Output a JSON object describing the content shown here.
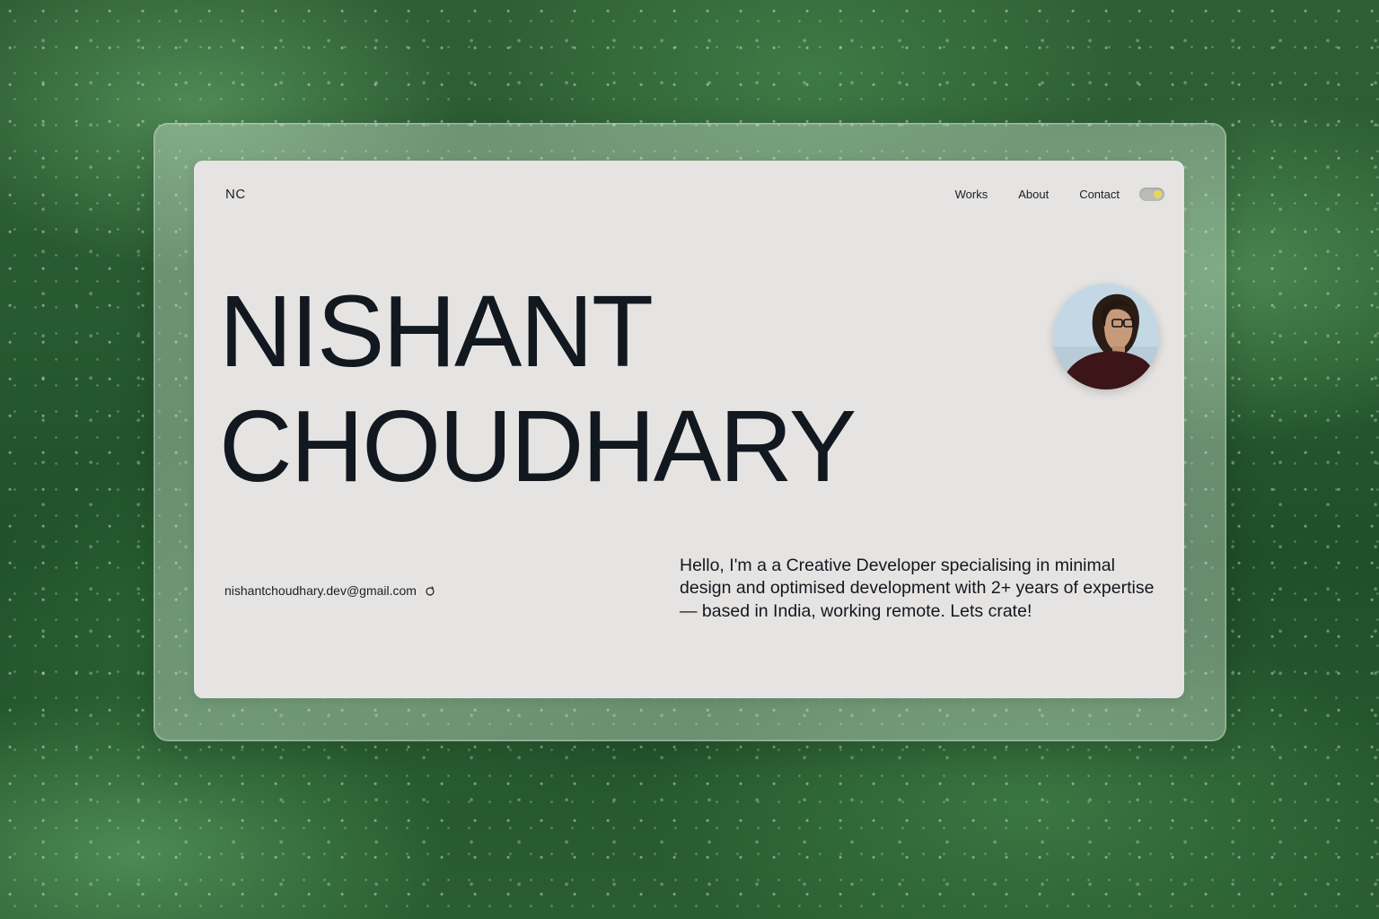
{
  "header": {
    "logo": "NC",
    "nav": [
      {
        "label": "Works"
      },
      {
        "label": "About"
      },
      {
        "label": "Contact"
      }
    ],
    "theme_toggle": {
      "state": "on",
      "knob_color": "#e8d65a"
    }
  },
  "hero": {
    "name_line1": "NISHANT",
    "name_line2": "CHOUDHARY"
  },
  "contact": {
    "email": "nishantchoudhary.dev@gmail.com",
    "copy_icon": "copy-icon"
  },
  "bio": {
    "text": "Hello, I'm a a Creative Developer specialising in minimal design and optimised development with 2+ years of expertise — based in India, working remote. Lets crate!"
  },
  "colors": {
    "card_bg": "#e6e4e2",
    "text": "#121820",
    "background_green": "#2f5f35"
  }
}
